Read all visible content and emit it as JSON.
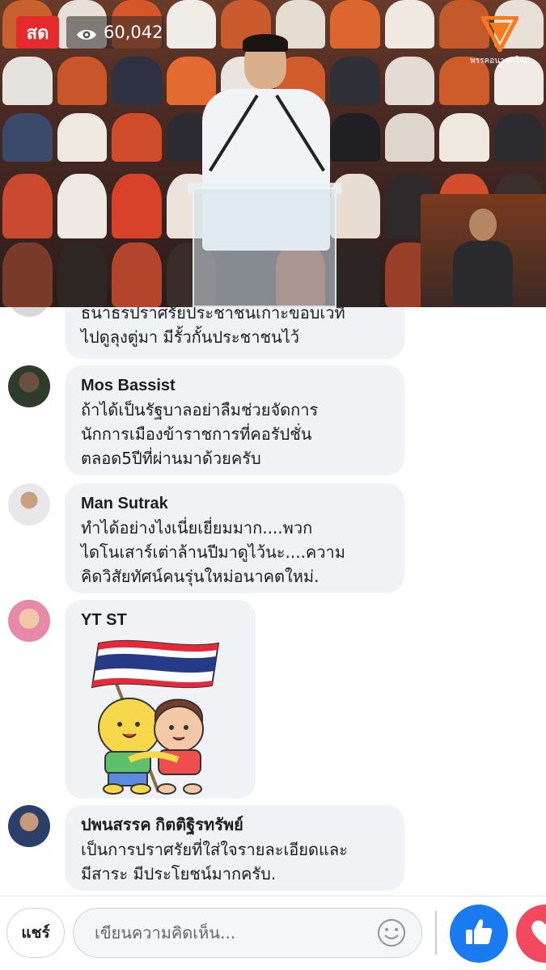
{
  "live": {
    "badge_label": "สด",
    "viewer_count": "60,042"
  },
  "brand": {
    "name": "พรรคอนาคตใหม่"
  },
  "comments": [
    {
      "author": "",
      "text": "ธนาธรปราศรัยประชาชนเกาะขอบเวที\nไปดูลุงตู่มา มีรั้วกั้นประชาชนไว้"
    },
    {
      "author": "Mos Bassist",
      "text": "ถ้าได้เป็นรัฐบาลอย่าลืมช่วยจัดการ\nนักการเมืองข้าราชการที่คอรัปชั่น\nตลอด5ปีที่ผ่านมาด้วยครับ"
    },
    {
      "author": "Man Sutrak",
      "text": "ทำได้อย่างไงเนี่ยเยี่ยมมาก....พวก\nไดโนเสาร์เต่าล้านปีมาดูไว้นะ....ความ\nคิดวิสัยทัศน์คนรุ่นใหม่อนาคตใหม่."
    },
    {
      "author": "YT ST",
      "text": "",
      "sticker": "thai-flag-kids-sticker"
    },
    {
      "author": "ปพนสรรค กิตติฐิรทรัพย์",
      "text": "เป็นการปราศรัยที่ใส่ใจรายละเอียดและ\nมีสาระ มีประโยชน์มากครับ."
    }
  ],
  "bottom_bar": {
    "share_label": "แชร์",
    "comment_placeholder": "เขียนความคิดเห็น..."
  },
  "colors": {
    "live_red": "#e42a2a",
    "brand_orange": "#f47b20",
    "like_blue": "#1a7af0",
    "love_pink": "#f2495e",
    "bubble_gray": "#f0f2f5"
  },
  "icons": [
    "eye-icon",
    "brand-logo-icon",
    "emoji-icon",
    "thumbs-up-icon",
    "heart-icon"
  ]
}
